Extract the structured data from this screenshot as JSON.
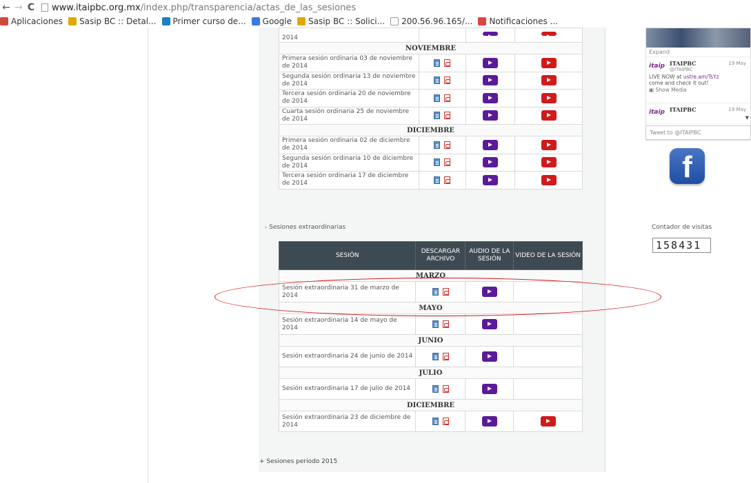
{
  "browser": {
    "url_domain": "www.itaipbc.org.mx",
    "url_path": "/index.php/transparencia/actas_de_las_sesiones",
    "back_glyph": "←",
    "forward_glyph": "→",
    "reload_glyph": "C"
  },
  "bookmarks": [
    {
      "label": "Aplicaciones",
      "icon": "apps-grid-icon",
      "color": "#d04a3a"
    },
    {
      "label": "Sasip BC :: Detal...",
      "icon": "sasip-icon",
      "color": "#e0a800"
    },
    {
      "label": "Primer curso de...",
      "icon": "calendar-icon",
      "color": "#1f7fc4"
    },
    {
      "label": "Google",
      "icon": "google-icon",
      "color": "#3b78e7"
    },
    {
      "label": "Sasip BC :: Solici...",
      "icon": "sasip-icon",
      "color": "#e0a800"
    },
    {
      "label": "200.56.96.165/...",
      "icon": "page-icon",
      "color": "#ffffff"
    },
    {
      "label": "Notificaciones ...",
      "icon": "notification-icon",
      "color": "#d44"
    }
  ],
  "ordinarias": [
    {
      "type": "month",
      "label": "NOVIEMBRE"
    },
    {
      "type": "row",
      "name": "Primera sesión ordinaria 03 de noviembre de 2014",
      "video": true
    },
    {
      "type": "row",
      "name": "Segunda sesión ordinaria 13 de noviembre de 2014",
      "video": true
    },
    {
      "type": "row",
      "name": "Tercera sesión ordinaria 20 de noviembre de 2014",
      "video": true
    },
    {
      "type": "row",
      "name": "Cuarta sesión ordinaria 25 de noviembre de 2014",
      "video": true
    },
    {
      "type": "month",
      "label": "DICIEMBRE"
    },
    {
      "type": "row",
      "name": "Primera sesión ordinaria 02 de diciembre de 2014",
      "video": true
    },
    {
      "type": "row",
      "name": "Segunda sesión ordinaria 10 de diciembre de 2014",
      "video": true
    },
    {
      "type": "row",
      "name": "Tercera sesión ordinaria 17 de diciembre de 2014",
      "video": true
    }
  ],
  "ordinarias_partial_label": "2014",
  "extraordinarias": {
    "section_label": "- Sesiones extraordinarias",
    "headers": [
      "SESIÓN",
      "DESCARGAR ARCHIVO",
      "AUDIO DE LA SESIÓN",
      "VIDEO DE LA SESIÓN"
    ],
    "rows": [
      {
        "type": "month",
        "label": "MARZO"
      },
      {
        "type": "row",
        "name": "Sesión extraordinaria 31 de marzo de 2014",
        "video": false
      },
      {
        "type": "month",
        "label": "MAYO"
      },
      {
        "type": "row",
        "name": "Sesión extraordinaria 14 de mayo de 2014",
        "video": false
      },
      {
        "type": "month",
        "label": "JUNIO"
      },
      {
        "type": "row",
        "name": "Sesión extraordinaria 24 de junio de 2014",
        "video": false
      },
      {
        "type": "month",
        "label": "JULIO"
      },
      {
        "type": "row",
        "name": "Sesión extraordinaria 17 de julio de 2014",
        "video": false
      },
      {
        "type": "month",
        "label": "DICIEMBRE"
      },
      {
        "type": "row",
        "name": "Sesión extraordinaria 23 de diciembre de 2014",
        "video": true
      }
    ]
  },
  "footer_link": "+ Sesiones periodo 2015",
  "twitter": {
    "expand": "Expand",
    "tweet1": {
      "logo": "itaip",
      "name": "ITAIPBC",
      "handle": "@ITAIPBC",
      "date": "19 May",
      "text_prefix": "LIVE NOW at ",
      "text_link": "ustre.am/TsYz",
      "text_suffix": "come and check it out!",
      "media": "Show Media"
    },
    "tweet2": {
      "logo": "itaip",
      "name": "ITAIPBC",
      "date": "19 May"
    },
    "tweet_to": "Tweet to @ITAIPBC"
  },
  "facebook_glyph": "f",
  "counter": {
    "label": "Contador de visitas",
    "value": "158431"
  },
  "colors": {
    "header_bg": "#3d4a52",
    "audio_button": "#5b1a9b",
    "video_button": "#d11a1a",
    "annotation": "#d21010"
  }
}
